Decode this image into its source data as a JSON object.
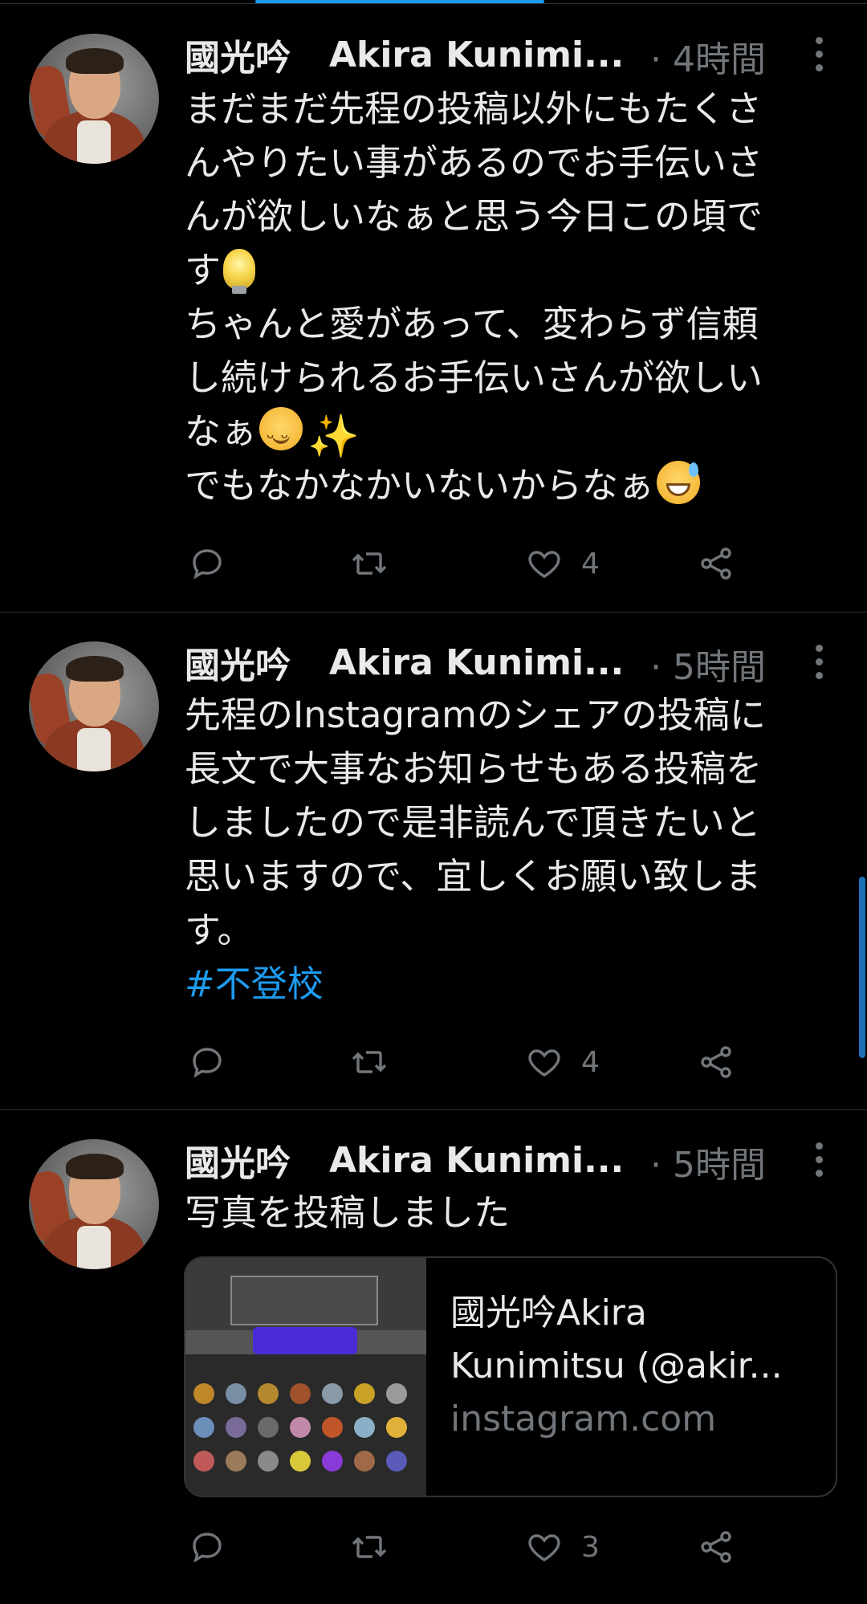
{
  "tweets": [
    {
      "author_name": "國光吟",
      "author_name_en": "Akira Kunimi...",
      "time": "· 4時間",
      "lines": [
        "まだまだ先程の投稿以外にもたくさ",
        "んやりたい事があるのでお手伝いさ",
        "んが欲しいなぁと思う今日この頃で",
        "す",
        "ちゃんと愛があって、変わらず信頼",
        "し続けられるお手伝いさんが欲しい",
        "なぁ",
        "でもなかなかいないからなぁ"
      ],
      "emojis": [
        "light-bulb",
        "smiling-face",
        "sparkles",
        "grinning-sweat"
      ],
      "reply_count": "",
      "retweet_count": "",
      "like_count": "4"
    },
    {
      "author_name": "國光吟",
      "author_name_en": "Akira Kunimi...",
      "time": "· 5時間",
      "lines": [
        "先程のInstagramのシェアの投稿に",
        "長文で大事なお知らせもある投稿を",
        "しましたので是非読んで頂きたいと",
        "思いますので、宜しくお願い致しま",
        "す。"
      ],
      "hashtag": "#不登校",
      "reply_count": "",
      "retweet_count": "",
      "like_count": "4"
    },
    {
      "author_name": "國光吟",
      "author_name_en": "Akira Kunimi...",
      "time": "· 5時間",
      "lines": [
        "写真を投稿しました"
      ],
      "card": {
        "title_line1": "國光吟Akira",
        "title_line2": "Kunimitsu (@akir...",
        "domain": "instagram.com"
      },
      "reply_count": "",
      "retweet_count": "",
      "like_count": "3"
    }
  ],
  "colors": {
    "background": "#000000",
    "text": "#e7e9ea",
    "secondary": "#71767b",
    "accent": "#1d9bf0",
    "divider": "#2f3336"
  },
  "icons": [
    "reply-icon",
    "retweet-icon",
    "like-icon",
    "share-icon",
    "more-icon"
  ]
}
